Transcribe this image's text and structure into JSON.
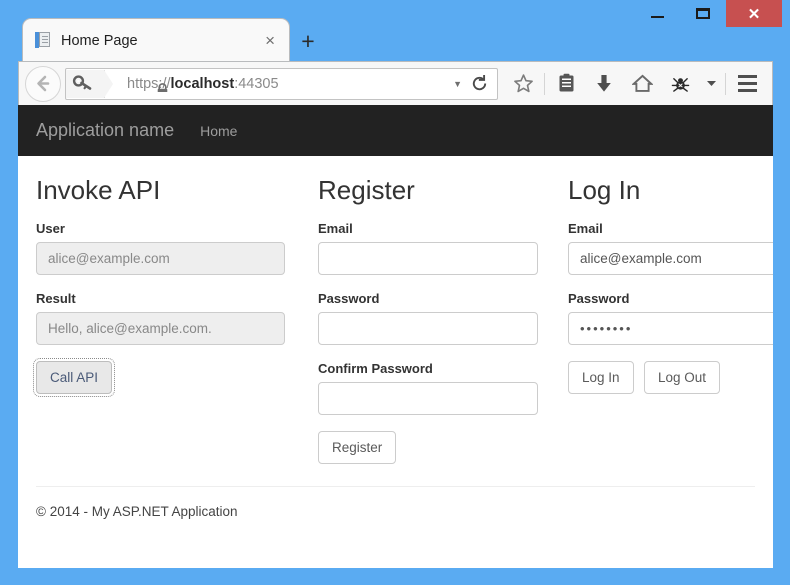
{
  "window": {
    "controls": {
      "minimize": "–",
      "maximize": "☐",
      "close": "✕"
    }
  },
  "browser": {
    "tab": {
      "title": "Home Page",
      "close_label": "×",
      "favicon": "document-favicon"
    },
    "new_tab_label": "+",
    "back_label": "←",
    "url": {
      "scheme": "https://",
      "host": "localhost",
      "port": ":44305",
      "full": "https://localhost:44305"
    },
    "url_dropdown_label": "▼",
    "reload_label": "⟳",
    "toolbar_icons": [
      "bookmark-star-icon",
      "reader-list-icon",
      "download-icon",
      "home-icon",
      "firebug-icon",
      "overflow-chevron-icon"
    ],
    "menu_label": "hamburger-menu"
  },
  "navbar": {
    "brand": "Application name",
    "links": [
      {
        "label": "Home"
      }
    ]
  },
  "columns": {
    "invoke": {
      "heading": "Invoke API",
      "user_label": "User",
      "user_value": "alice@example.com",
      "result_label": "Result",
      "result_value": "Hello, alice@example.com.",
      "call_api_label": "Call API"
    },
    "register": {
      "heading": "Register",
      "email_label": "Email",
      "email_value": "",
      "password_label": "Password",
      "password_value": "",
      "confirm_label": "Confirm Password",
      "confirm_value": "",
      "submit_label": "Register"
    },
    "login": {
      "heading": "Log In",
      "email_label": "Email",
      "email_value": "alice@example.com",
      "password_label": "Password",
      "password_value": "••••••••",
      "login_label": "Log In",
      "logout_label": "Log Out"
    }
  },
  "footer": {
    "text": "© 2014 - My ASP.NET Application"
  },
  "colors": {
    "window_chrome": "#5aabf2",
    "close_button": "#c75050",
    "navbar_bg": "#222222",
    "navbar_text": "#9d9d9d",
    "readonly_field_bg": "#eeeeee"
  }
}
